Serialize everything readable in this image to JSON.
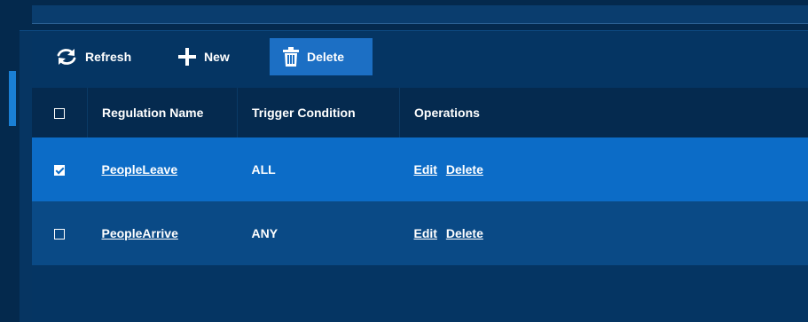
{
  "toolbar": {
    "refresh_label": "Refresh",
    "new_label": "New",
    "delete_label": "Delete"
  },
  "table": {
    "headers": [
      "Regulation Name",
      "Trigger Condition",
      "Operations"
    ],
    "rows": [
      {
        "checked": true,
        "name": "PeopleLeave",
        "trigger": "ALL",
        "edit": "Edit",
        "delete": "Delete"
      },
      {
        "checked": false,
        "name": "PeopleArrive",
        "trigger": "ANY",
        "edit": "Edit",
        "delete": "Delete"
      }
    ]
  },
  "icons": {
    "refresh": "refresh-icon",
    "new": "plus-icon",
    "delete": "trash-icon"
  },
  "colors": {
    "background": "#063562",
    "header_row": "#052a4f",
    "selected_row": "#0c6cc7",
    "normal_row": "#0a4a86",
    "delete_button": "#1c6fc4"
  }
}
